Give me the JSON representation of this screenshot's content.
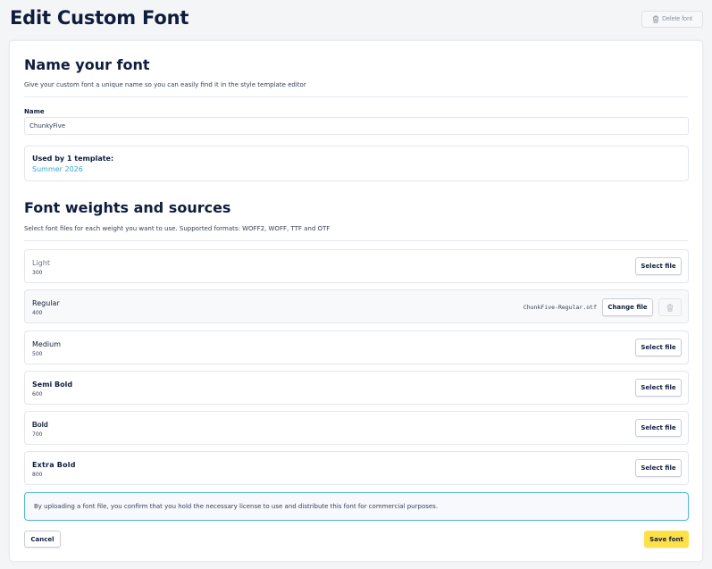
{
  "header": {
    "title": "Edit Custom Font",
    "delete_label": "Delete font"
  },
  "name_section": {
    "title": "Name your font",
    "description": "Give your custom font a unique name so you can easily find it in the style template editor",
    "field_label": "Name",
    "field_value": "ChunkyFive",
    "usage_title": "Used by 1 template:",
    "usage_link": "Summer 2026"
  },
  "weights_section": {
    "title": "Font weights and sources",
    "description": "Select font files for each weight you want to use. Supported formats: WOFF2, WOFF, TTF and OTF",
    "select_label": "Select file",
    "change_label": "Change file",
    "weights": [
      {
        "name": "Light",
        "value": "300",
        "file": ""
      },
      {
        "name": "Regular",
        "value": "400",
        "file": "ChunkFive-Regular.otf"
      },
      {
        "name": "Medium",
        "value": "500",
        "file": ""
      },
      {
        "name": "Semi Bold",
        "value": "600",
        "file": ""
      },
      {
        "name": "Bold",
        "value": "700",
        "file": ""
      },
      {
        "name": "Extra Bold",
        "value": "800",
        "file": ""
      }
    ]
  },
  "notice": "By uploading a font file, you confirm that you hold the necessary license to use and distribute this font for commercial purposes.",
  "footer": {
    "cancel_label": "Cancel",
    "save_label": "Save font"
  },
  "colors": {
    "accent": "#ffe147",
    "link": "#3aa3d6",
    "notice_border": "#4fb8d9",
    "heading": "#0f1d3d"
  },
  "icons": {
    "delete": "trash-icon"
  }
}
